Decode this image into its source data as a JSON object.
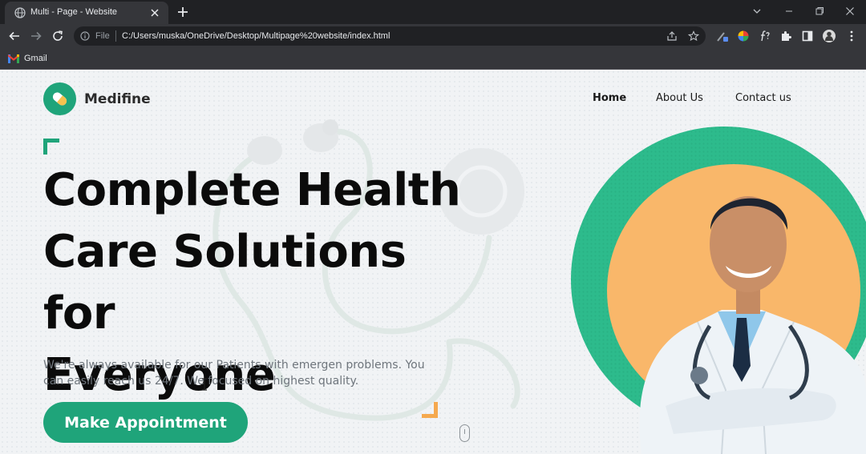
{
  "browser": {
    "tab_title": "Multi - Page - Website",
    "address_scheme_label": "File",
    "url": "C:/Users/muska/OneDrive/Desktop/Multipage%20website/index.html",
    "bookmarks": [
      {
        "label": "Gmail"
      }
    ]
  },
  "site": {
    "brand": "Medifine",
    "nav": [
      {
        "label": "Home",
        "active": true
      },
      {
        "label": "About Us"
      },
      {
        "label": "Contact us"
      }
    ],
    "hero": {
      "headline_lines": [
        "Complete Health",
        "Care Solutions for",
        "Everyone"
      ],
      "description": "We're always available for our Patients with emergen problems. You can easily reach us 24/7. We focused on highest quality.",
      "cta_label": "Make Appointment"
    }
  },
  "colors": {
    "brand_green": "#1fa47a",
    "accent_orange": "#f5a94f",
    "page_bg": "#f1f3f5",
    "browser_dark": "#202124"
  },
  "icons": [
    "globe-icon",
    "close-icon",
    "plus-icon",
    "back-icon",
    "forward-icon",
    "reload-icon",
    "info-icon",
    "share-icon",
    "star-icon",
    "puzzle-icon",
    "sidebar-icon",
    "profile-avatar",
    "menu-dots-icon",
    "gmail-icon",
    "pill-icon",
    "mouse-scroll-icon",
    "text-cursor-icon"
  ]
}
